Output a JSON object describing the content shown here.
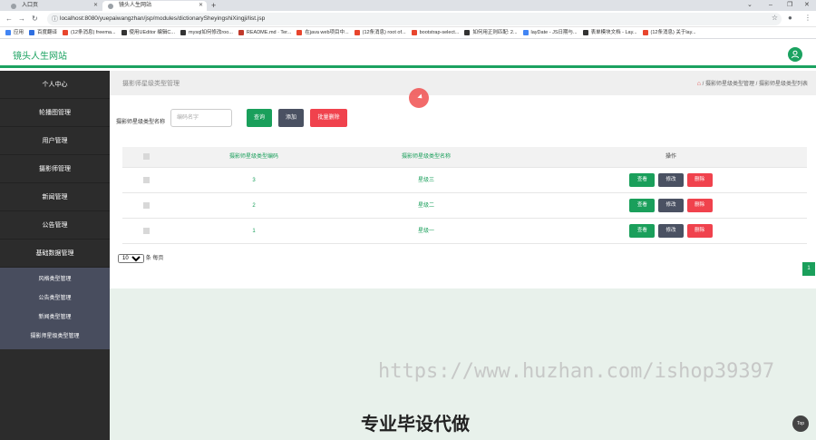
{
  "browser": {
    "tabs": [
      {
        "label": "入口页",
        "active": false
      },
      {
        "label": "镜头人生网站",
        "active": true
      }
    ],
    "url": "localhost:8080/yuepaiwangzhan/jsp/modules/dictionarySheyingshiXingji/list.jsp",
    "bookmarks": [
      {
        "label": "应用",
        "color": "#4285f4"
      },
      {
        "label": "百度翻译",
        "color": "#2f6fe0"
      },
      {
        "label": "(12条消息) freema...",
        "color": "#e8452d"
      },
      {
        "label": "使用UEditor 编辑C...",
        "color": "#333333"
      },
      {
        "label": "mysql如何修改roo...",
        "color": "#333333"
      },
      {
        "label": "README.md · Ter...",
        "color": "#c0392b"
      },
      {
        "label": "在java web项目中...",
        "color": "#e8452d"
      },
      {
        "label": "(12条消息) root of...",
        "color": "#e8452d"
      },
      {
        "label": "bootstrap-select...",
        "color": "#e8452d"
      },
      {
        "label": "如何用正则匹配: 2...",
        "color": "#333333"
      },
      {
        "label": "layDate - JS日期与...",
        "color": "#4285f4"
      },
      {
        "label": "表单模块文档 - Lay...",
        "color": "#333333"
      },
      {
        "label": "(12条消息) 关于lay...",
        "color": "#e8452d"
      }
    ]
  },
  "header": {
    "site_title": "镜头人生网站",
    "avatar_icon": "user-icon"
  },
  "sidebar": {
    "items": [
      {
        "label": "个人中心"
      },
      {
        "label": "轮播图管理"
      },
      {
        "label": "用户管理"
      },
      {
        "label": "摄影师管理"
      },
      {
        "label": "新闻管理"
      },
      {
        "label": "公告管理"
      },
      {
        "label": "基础数据管理"
      }
    ],
    "sub_items": [
      {
        "label": "风格类型管理"
      },
      {
        "label": "公告类型管理"
      },
      {
        "label": "新闻类型管理"
      },
      {
        "label": "摄影师星级类型管理"
      }
    ]
  },
  "main": {
    "page_title": "摄影师星级类型管理",
    "breadcrumb": "/ 摄影师星级类型管理 / 摄影师星级类型列表",
    "search": {
      "label": "摄影师星级类型名称",
      "placeholder": "编码名字"
    },
    "buttons": {
      "search": "查询",
      "add": "添加",
      "bulk_delete": "批量删除"
    },
    "table": {
      "headers": {
        "code": "摄影师星级类型编码",
        "name": "摄影师星级类型名称",
        "ops": "操作"
      },
      "rows": [
        {
          "code": "3",
          "name": "星级三"
        },
        {
          "code": "2",
          "name": "星级二"
        },
        {
          "code": "1",
          "name": "星级一"
        }
      ],
      "row_actions": {
        "view": "查看",
        "edit": "修改",
        "delete": "删除"
      }
    },
    "pagination": {
      "page_size": "10",
      "page_size_suffix": "条 每页",
      "current_page": "1"
    }
  },
  "overlay": {
    "watermark": "https://www.huzhan.com/ishop39397",
    "promo": "专业毕设代做",
    "top_button": "Top"
  },
  "colors": {
    "brand": "#1ba260",
    "danger": "#f0424d",
    "dark": "#4a5162",
    "sidebar": "#2c2c2c"
  }
}
